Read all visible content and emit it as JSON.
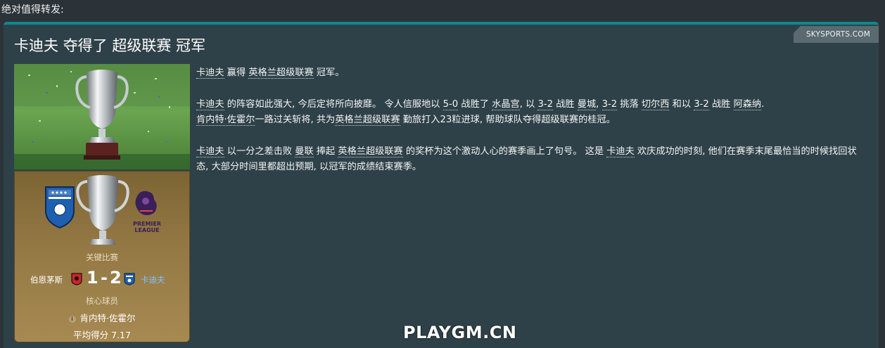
{
  "post": {
    "header": "绝对值得转发:"
  },
  "news": {
    "source": "SKYSPORTS.COM",
    "title": "卡迪夫 夺得了 超级联赛 冠军",
    "paragraph1": [
      "卡迪夫",
      " 赢得 ",
      "英格兰超级联赛",
      " 冠军。"
    ],
    "paragraph2_line1": [
      "卡迪夫",
      " 的阵容如此强大, 今后定将所向披靡。 令人信服地以 ",
      "5-0",
      " 战胜了 ",
      "水晶宫",
      ", 以 ",
      "3-2",
      " 战胜 ",
      "曼城",
      ", ",
      "3-2",
      " 挑落 ",
      "切尔西",
      " 和以 ",
      "3-2",
      " 战胜 ",
      "阿森纳",
      "."
    ],
    "paragraph2_line2": [
      "肯内特·佐霍尔",
      "一路过关斩将, 共为",
      "英格兰超级联赛",
      " 勤旅打入23粒进球, 帮助球队夺得超级联赛的桂冠。"
    ],
    "paragraph3": [
      "卡迪夫",
      " 以一分之差击败 ",
      "曼联",
      " 捧起 ",
      "英格兰超级联赛",
      " 的奖杯为这个激动人心的赛季画上了句号。 这是 ",
      "卡迪夫",
      " 欢庆成功的时刻, 他们在赛季末尾最恰当的时候找回状态, 大部分时间里都超出预期, 以冠军的成绩结束赛季。"
    ]
  },
  "card": {
    "league_logo_text": [
      "PREMIER",
      "LEAGUE"
    ],
    "key_match_label": "关键比赛",
    "home_team": "伯恩茅斯",
    "home_score": "1",
    "dash": "-",
    "away_score": "2",
    "away_team": "卡迪夫",
    "key_player_label": "核心球员",
    "key_player": "肯内特·佐霍尔",
    "average_rating": "平均得分 7.17"
  },
  "watermark": "PLAYGM.CN",
  "colors": {
    "accent_teal": "#0e8a8e",
    "panel": "#2f4148",
    "card_gold": "#927743",
    "away_team_link": "#7fc2ff"
  },
  "icons": {
    "trophy": "trophy-icon",
    "club_crest": "club-crest-icon",
    "league_logo": "premier-league-lion-icon",
    "info": "info-icon"
  }
}
